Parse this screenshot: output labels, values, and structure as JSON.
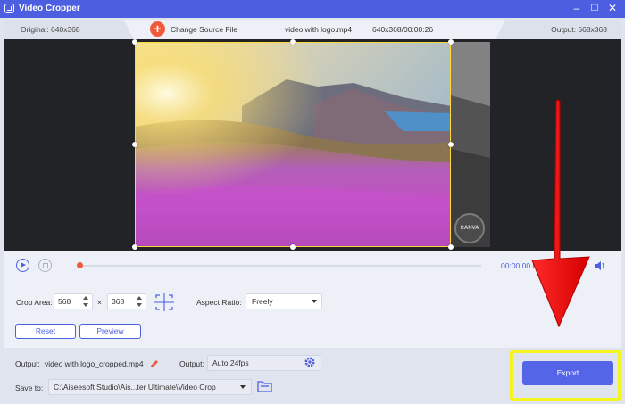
{
  "window": {
    "title": "Video Cropper"
  },
  "info": {
    "original": "Original: 640x368",
    "change_source": "Change Source File",
    "file_name": "video with logo.mp4",
    "file_meta": "640x368/00:00:26",
    "output_size": "Output: 568x368"
  },
  "preview": {
    "watermark_text": "CANVA"
  },
  "player": {
    "timecode": "00:00:00.00/00:00:26"
  },
  "crop": {
    "label": "Crop Area:",
    "width": "568",
    "separator": "×",
    "height": "368",
    "aspect_label": "Aspect Ratio:",
    "aspect_value": "Freely",
    "reset": "Reset",
    "preview": "Preview"
  },
  "output": {
    "label": "Output:",
    "file_name": "video with logo_cropped.mp4",
    "format_label": "Output:",
    "format_value": "Auto;24fps"
  },
  "save": {
    "label": "Save to:",
    "path": "C:\\Aiseesoft Studio\\Ais...ter Ultimate\\Video Crop"
  },
  "export": {
    "label": "Export"
  },
  "colors": {
    "accent": "#4d5fe1",
    "highlight": "#f4f41f",
    "arrow": "#ff0000"
  }
}
